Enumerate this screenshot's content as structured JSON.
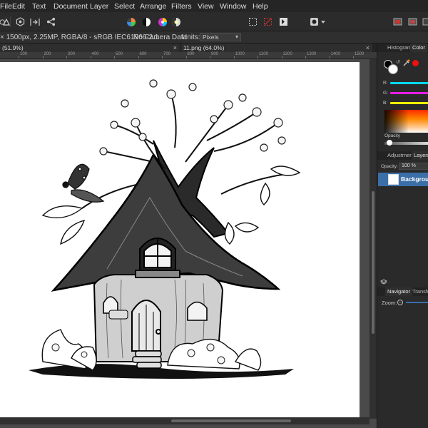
{
  "menu": [
    "File",
    "Edit",
    "Text",
    "Document",
    "Layer",
    "Select",
    "Arrange",
    "Filters",
    "View",
    "Window",
    "Help"
  ],
  "context_bar": {
    "info": "× 1500px, 2.25MP, RGBA/8 - sRGB IEC61966-2.1",
    "camera": "No Camera Data",
    "units_label": "Units:",
    "units_value": "Pixels"
  },
  "doc_tabs": [
    {
      "label": "(51.9%)",
      "close": "×"
    },
    {
      "label": "11.png (64.0%)",
      "close": "×"
    }
  ],
  "ruler_ticks": [
    "100",
    "200",
    "300",
    "400",
    "500",
    "600",
    "700",
    "800",
    "900",
    "1000",
    "1100",
    "1200",
    "1300",
    "1400",
    "1500"
  ],
  "panels": {
    "top_tabs": [
      "Histogram",
      "Color"
    ],
    "rgb_labels": [
      "R:",
      "G:",
      "B:"
    ],
    "opacity_label": "Opacity",
    "mid_tabs": [
      "Adjustment",
      "Layers"
    ],
    "layer_opacity_label": "Opacity:",
    "layer_opacity_value": "100 %",
    "layer_name": "Background",
    "bottom_tabs": [
      "Navigator",
      "Transform"
    ],
    "zoom_label": "Zoom:"
  },
  "colors": {
    "accent_blue": "#3b6fa8",
    "r_slider": "#00d8ff",
    "g_slider": "#e91ee6",
    "b_slider": "#f5f500"
  }
}
